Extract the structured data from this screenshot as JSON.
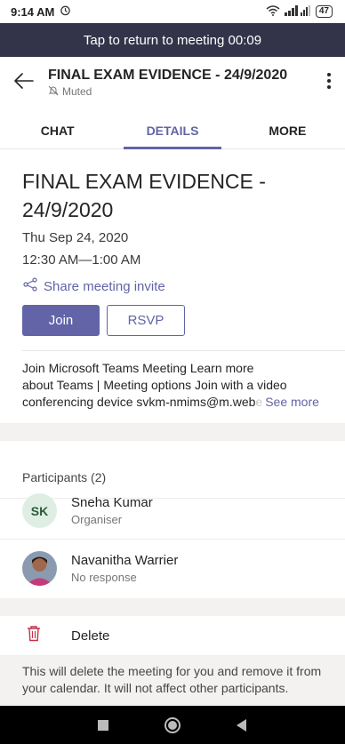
{
  "status_bar": {
    "time": "9:14 AM",
    "battery": "47"
  },
  "banner": {
    "text": "Tap to return to meeting 00:09"
  },
  "header": {
    "title": "FINAL EXAM EVIDENCE - 24/9/2020",
    "subtitle": "Muted"
  },
  "tabs": [
    {
      "label": "CHAT",
      "active": false
    },
    {
      "label": "DETAILS",
      "active": true
    },
    {
      "label": "MORE",
      "active": false
    }
  ],
  "meeting": {
    "title_line1": "FINAL EXAM EVIDENCE -",
    "title_line2": "24/9/2020",
    "date": "Thu Sep 24, 2020",
    "time": "12:30 AM—1:00 AM",
    "share_label": "Share meeting invite",
    "join_label": "Join",
    "rsvp_label": "RSVP"
  },
  "description": {
    "line1": "Join Microsoft Teams Meeting Learn more",
    "line2": "about Teams | Meeting options Join with a video",
    "line3": "conferencing device svkm-nmims@m.web",
    "line3_faded": "e",
    "see_more": "See more"
  },
  "participants": {
    "header": "Participants (2)",
    "items": [
      {
        "initials": "SK",
        "name": "Sneha Kumar",
        "role": "Organiser"
      },
      {
        "name": "Navanitha Warrier",
        "role": "No response"
      }
    ]
  },
  "delete": {
    "label": "Delete",
    "note": "This will delete the meeting for you and remove it from your calendar. It will not affect other participants."
  },
  "colors": {
    "accent": "#6264a7",
    "banner": "#33344a"
  },
  "icons": [
    "alarm-icon",
    "wifi-icon",
    "signal-icon",
    "battery-icon",
    "back-arrow-icon",
    "muted-bell-icon",
    "more-vertical-icon",
    "share-icon",
    "trash-icon",
    "nav-square-icon",
    "nav-circle-icon",
    "nav-back-icon"
  ]
}
